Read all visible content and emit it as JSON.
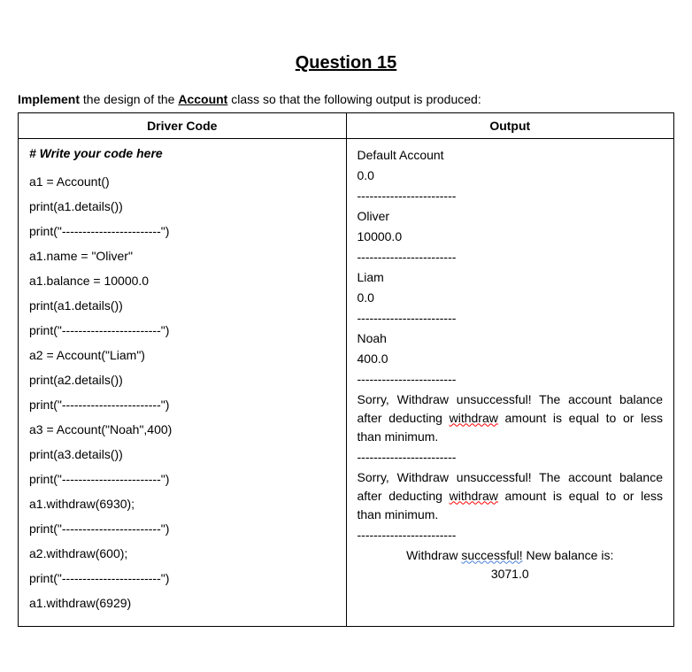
{
  "title": "Question 15",
  "instruction": {
    "part1": "Implement",
    "part2": " the design of the ",
    "part3": "Account",
    "part4": " class so that the following output is produced:"
  },
  "headers": {
    "driver": "Driver Code",
    "output": "Output"
  },
  "code": {
    "comment": "# Write your code here",
    "l1": "a1 = Account()",
    "l2": "print(a1.details())",
    "l3": "print(\"------------------------\")",
    "l4": "a1.name = \"Oliver\"",
    "l5": "a1.balance = 10000.0",
    "l6": "print(a1.details())",
    "l7": "print(\"------------------------\")",
    "l8": "a2 = Account(\"Liam\")",
    "l9": "print(a2.details())",
    "l10": "print(\"------------------------\")",
    "l11": "a3 = Account(\"Noah\",400)",
    "l12": "print(a3.details())",
    "l13": "print(\"------------------------\")",
    "l14": "a1.withdraw(6930);",
    "l15": "print(\"------------------------\")",
    "l16": "a2.withdraw(600);",
    "l17": "print(\"------------------------\")",
    "l18": "a1.withdraw(6929)"
  },
  "output": {
    "o1": "Default Account",
    "o2": "0.0",
    "sep": "------------------------",
    "o3": "Oliver",
    "o4": "10000.0",
    "o5": "Liam",
    "o6": "0.0",
    "o7": "Noah",
    "o8": "400.0",
    "err_p1": "Sorry, Withdraw unsuccessful! The account balance after deducting ",
    "err_withdraw": "withdraw",
    "err_p2": " amount is equal to or less than minimum.",
    "succ_p1": "Withdraw ",
    "succ_word": "successful!",
    "succ_p2": " New balance is:",
    "succ_val": "3071.0"
  }
}
